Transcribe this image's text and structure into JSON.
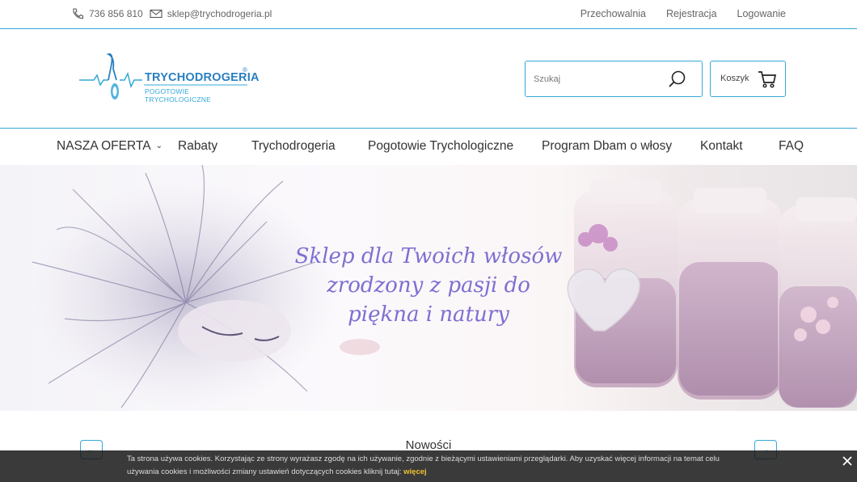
{
  "topbar": {
    "phone": "736 856 810",
    "email": "sklep@trychodrogeria.pl",
    "links": [
      "Przechowalnia",
      "Rejestracja",
      "Logowanie"
    ]
  },
  "logo": {
    "title": "TRYCHODROGERIA",
    "registered": "®",
    "subtitle": "POGOTOWIE TRYCHOLOGICZNE"
  },
  "search": {
    "placeholder": "Szukaj"
  },
  "cart": {
    "label": "Koszyk"
  },
  "nav": {
    "items": [
      "NASZA OFERTA",
      "Rabaty",
      "Trychodrogeria",
      "Pogotowie Trychologiczne",
      "Program Dbam o włosy",
      "Kontakt",
      "FAQ"
    ]
  },
  "hero": {
    "line1": "Sklep dla Twoich włosów",
    "line2": "zrodzony z pasji do",
    "line3": "piękna i natury"
  },
  "section": {
    "title": "Nowości",
    "prev_arrow": "←",
    "next_arrow": "→"
  },
  "cookie": {
    "text": "Ta strona używa cookies. Korzystając ze strony wyrażasz zgodę na ich używanie, zgodnie z bieżącymi ustawieniami przeglądarki. Aby uzyskać więcej informacji na temat celu używania cookies i możliwości zmiany ustawień dotyczących cookies kliknij tutaj:",
    "more": "więcej"
  },
  "colors": {
    "accent": "#35a8d9",
    "brand": "#2a7fc0",
    "hero_text": "#7e6fd1",
    "cookie_link": "#f1c232"
  },
  "icons": [
    "phone-icon",
    "envelope-icon",
    "search-icon",
    "cart-icon",
    "chevron-down-icon",
    "close-icon"
  ]
}
